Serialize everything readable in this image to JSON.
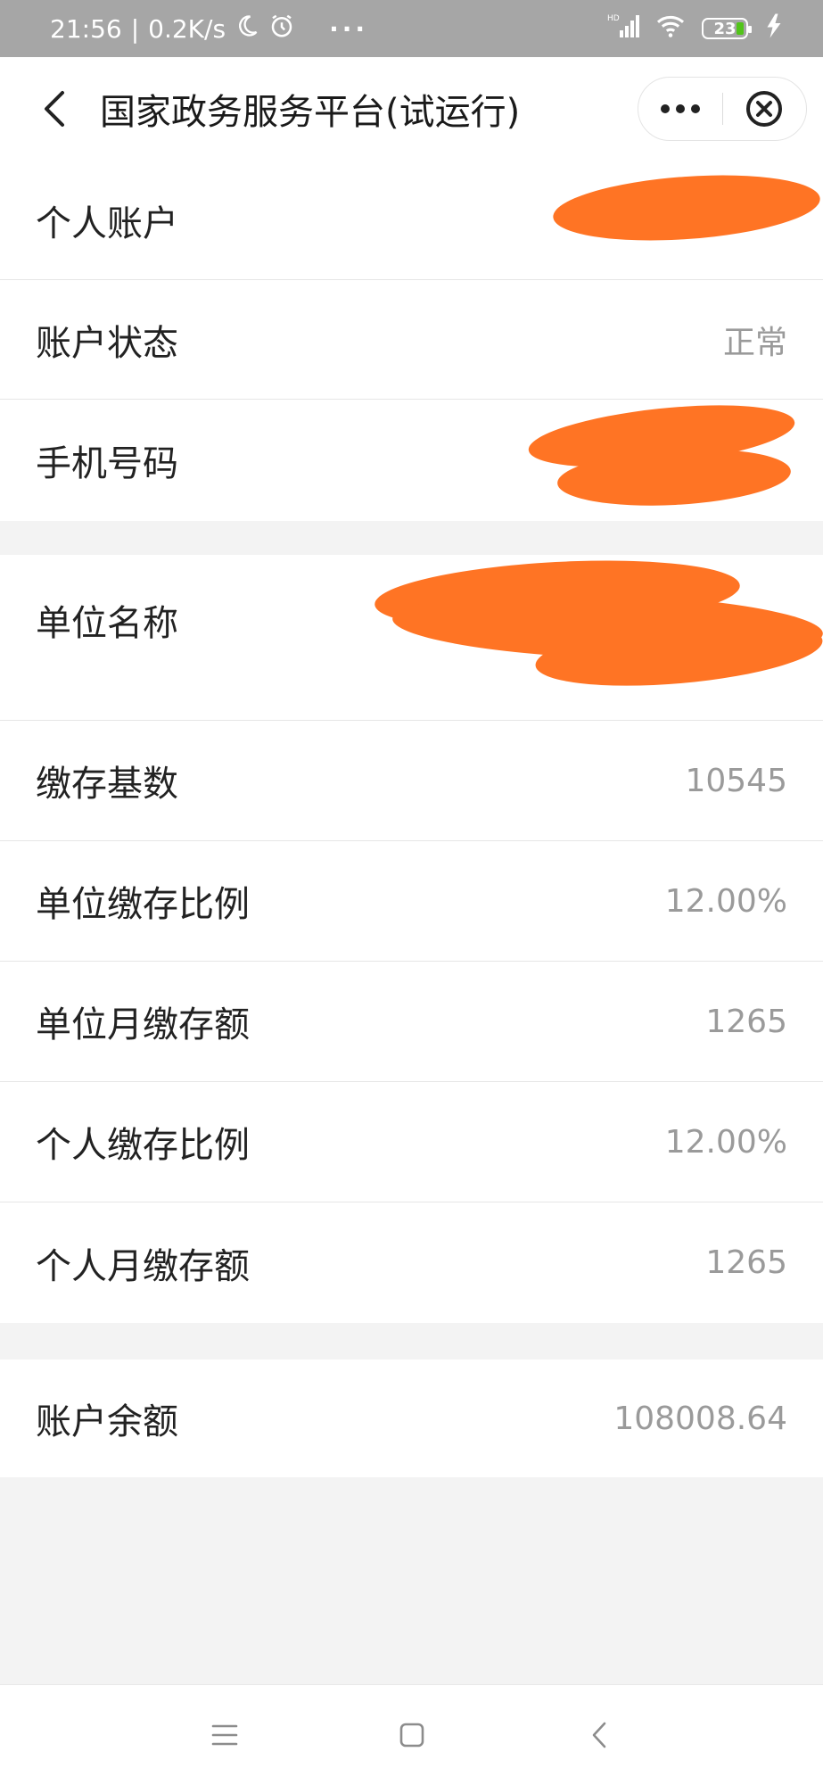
{
  "status_bar": {
    "time": "21:56",
    "separator": "|",
    "net_speed": "0.2K/s",
    "more": "···",
    "battery_level": "23"
  },
  "nav_bar": {
    "title": "国家政务服务平台(试运行)"
  },
  "rows": {
    "personal_account": {
      "label": "个人账户",
      "value": ""
    },
    "account_status": {
      "label": "账户状态",
      "value": "正常"
    },
    "phone_number": {
      "label": "手机号码",
      "value": ""
    },
    "employer_name": {
      "label": "单位名称",
      "value": ""
    },
    "contribution_base": {
      "label": "缴存基数",
      "value": "10545"
    },
    "employer_rate": {
      "label": "单位缴存比例",
      "value": "12.00%"
    },
    "employer_monthly": {
      "label": "单位月缴存额",
      "value": "1265"
    },
    "personal_rate": {
      "label": "个人缴存比例",
      "value": "12.00%"
    },
    "personal_monthly": {
      "label": "个人月缴存额",
      "value": "1265"
    },
    "balance": {
      "label": "账户余额",
      "value": "108008.64"
    }
  },
  "colors": {
    "redaction": "#ff7424",
    "status_bar": "#a6a6a6",
    "battery_fill": "#52c41a"
  }
}
